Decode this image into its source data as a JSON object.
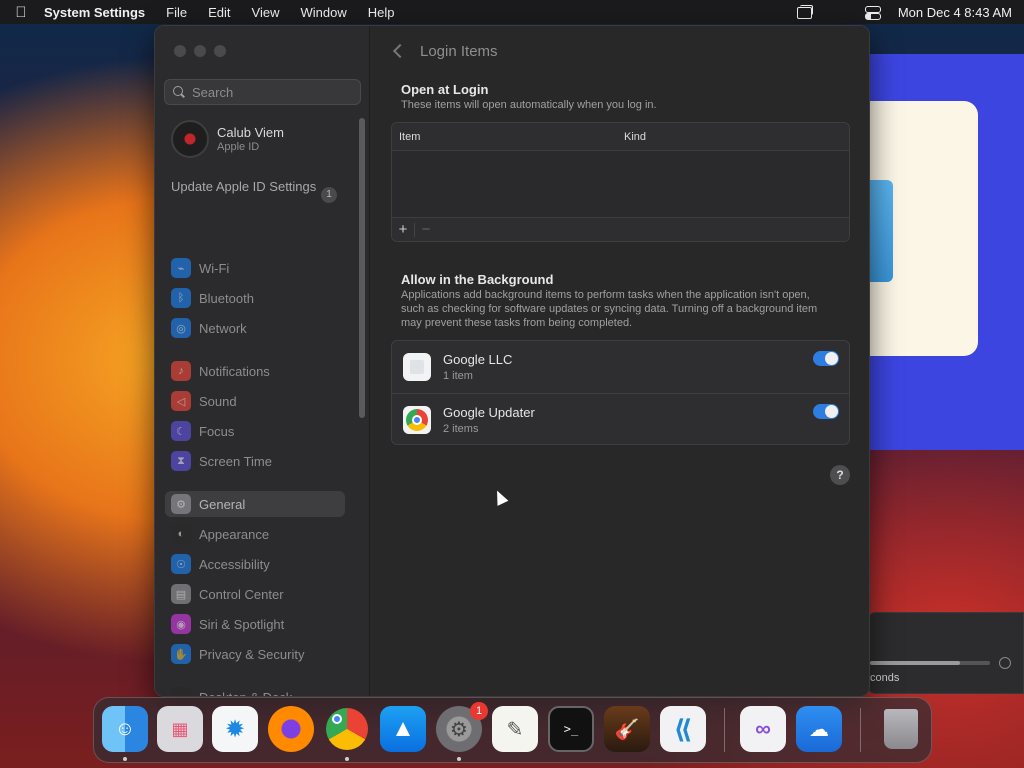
{
  "menubar": {
    "app_name": "System Settings",
    "menus": [
      "File",
      "Edit",
      "View",
      "Window",
      "Help"
    ],
    "clock": "Mon Dec 4  8:43 AM"
  },
  "background_window": {
    "text": "conds"
  },
  "sidebar": {
    "search_placeholder": "Search",
    "profile": {
      "name": "Calub Viem",
      "subtitle": "Apple ID"
    },
    "update_item": {
      "label": "Update Apple ID Settings",
      "badge": "1"
    },
    "items": [
      {
        "label": "Wi-Fi",
        "icon": "wifi-icon",
        "color": "#1f7ae0"
      },
      {
        "label": "Bluetooth",
        "icon": "bluetooth-icon",
        "color": "#1f7ae0"
      },
      {
        "label": "Network",
        "icon": "globe-icon",
        "color": "#1f7ae0"
      },
      {
        "label": "Notifications",
        "icon": "bell-icon",
        "color": "#e0453a"
      },
      {
        "label": "Sound",
        "icon": "speaker-icon",
        "color": "#e0453a"
      },
      {
        "label": "Focus",
        "icon": "moon-icon",
        "color": "#5a4fd0"
      },
      {
        "label": "Screen Time",
        "icon": "hourglass-icon",
        "color": "#5a4fd0"
      },
      {
        "label": "General",
        "icon": "gear-icon",
        "color": "#8e8e93"
      },
      {
        "label": "Appearance",
        "icon": "appearance-icon",
        "color": "#2a2a2a"
      },
      {
        "label": "Accessibility",
        "icon": "accessibility-icon",
        "color": "#1f7ae0"
      },
      {
        "label": "Control Center",
        "icon": "control-center-icon",
        "color": "#8e8e93"
      },
      {
        "label": "Siri & Spotlight",
        "icon": "siri-icon",
        "color": "#c23ad0"
      },
      {
        "label": "Privacy & Security",
        "icon": "hand-icon",
        "color": "#1f7ae0"
      },
      {
        "label": "Desktop & Dock",
        "icon": "dock-icon",
        "color": "#2a2a2a"
      }
    ],
    "selected": "General"
  },
  "content": {
    "title": "Login Items",
    "open_at_login": {
      "title": "Open at Login",
      "description": "These items will open automatically when you log in.",
      "columns": [
        "Item",
        "Kind"
      ],
      "add_label": "+",
      "remove_label": "−"
    },
    "background": {
      "title": "Allow in the Background",
      "description": "Applications add background items to perform tasks when the application isn't open, such as checking for software updates or syncing data. Turning off a background item may prevent these tasks from being completed.",
      "items": [
        {
          "name": "Google LLC",
          "count": "1 item",
          "enabled": true
        },
        {
          "name": "Google Updater",
          "count": "2 items",
          "enabled": true
        }
      ]
    },
    "help_label": "?"
  },
  "dock": {
    "apps": [
      "Finder",
      "Launchpad",
      "Safari",
      "Firefox",
      "Google Chrome",
      "App Store",
      "System Settings",
      "TextEdit",
      "Terminal",
      "GarageBand",
      "Visual Studio Code",
      "Visual Studio",
      "Weather",
      "Trash"
    ],
    "system_settings_badge": "1",
    "terminal_glyph": ">_"
  },
  "colors": {
    "accent": "#2f7de1",
    "window_bg": "#282828",
    "sidebar_bg": "#2b2a2d"
  }
}
